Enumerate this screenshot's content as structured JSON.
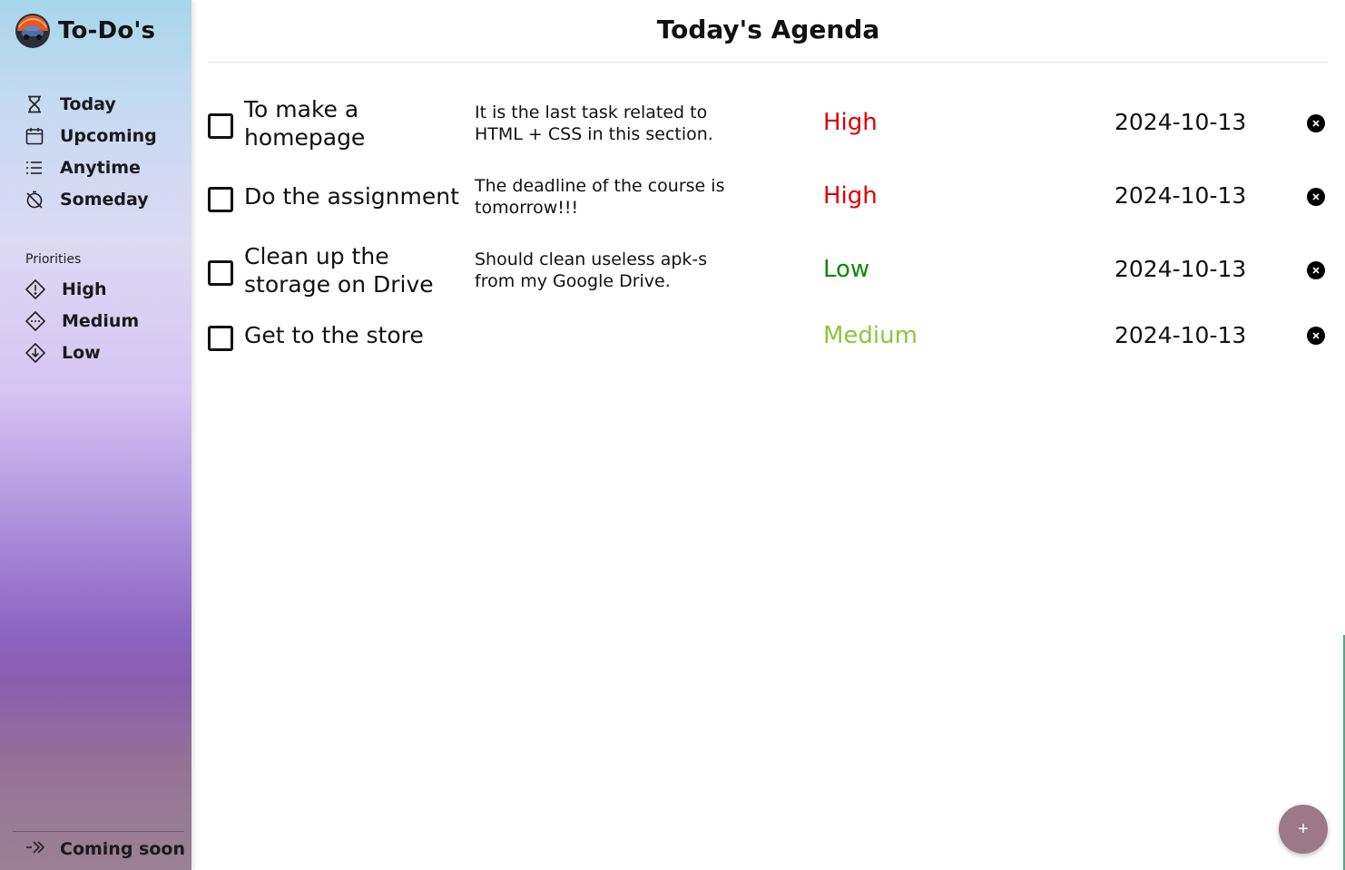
{
  "app": {
    "title": "To-Do's",
    "logo_icon": "car-logo-icon"
  },
  "sidebar": {
    "nav": [
      {
        "label": "Today",
        "icon": "hourglass-icon"
      },
      {
        "label": "Upcoming",
        "icon": "calendar-icon"
      },
      {
        "label": "Anytime",
        "icon": "list-icon"
      },
      {
        "label": "Someday",
        "icon": "timer-off-icon"
      }
    ],
    "priorities_heading": "Priorities",
    "priorities": [
      {
        "label": "High",
        "icon": "diamond-exclamation-icon"
      },
      {
        "label": "Medium",
        "icon": "diamond-dots-icon"
      },
      {
        "label": "Low",
        "icon": "diamond-arrow-down-icon"
      }
    ],
    "footer": {
      "label": "Coming soon",
      "icon": "double-arrow-right-icon"
    }
  },
  "main": {
    "title": "Today's Agenda",
    "tasks": [
      {
        "name": "To make a homepage",
        "description": "It is the last task related to HTML + CSS in this section.",
        "priority": "High",
        "priority_color": "#e00000",
        "date": "2024-10-13",
        "checked": false
      },
      {
        "name": "Do the assignment",
        "description": "The deadline of the course is tomorrow!!!",
        "priority": "High",
        "priority_color": "#e00000",
        "date": "2024-10-13",
        "checked": false
      },
      {
        "name": "Clean up the storage on Drive",
        "description": "Should clean useless apk-s from my Google Drive.",
        "priority": "Low",
        "priority_color": "#0a8a0a",
        "date": "2024-10-13",
        "checked": false
      },
      {
        "name": "Get to the store",
        "description": "",
        "priority": "Medium",
        "priority_color": "#8cc63f",
        "date": "2024-10-13",
        "checked": false
      }
    ],
    "add_button_label": "+"
  }
}
